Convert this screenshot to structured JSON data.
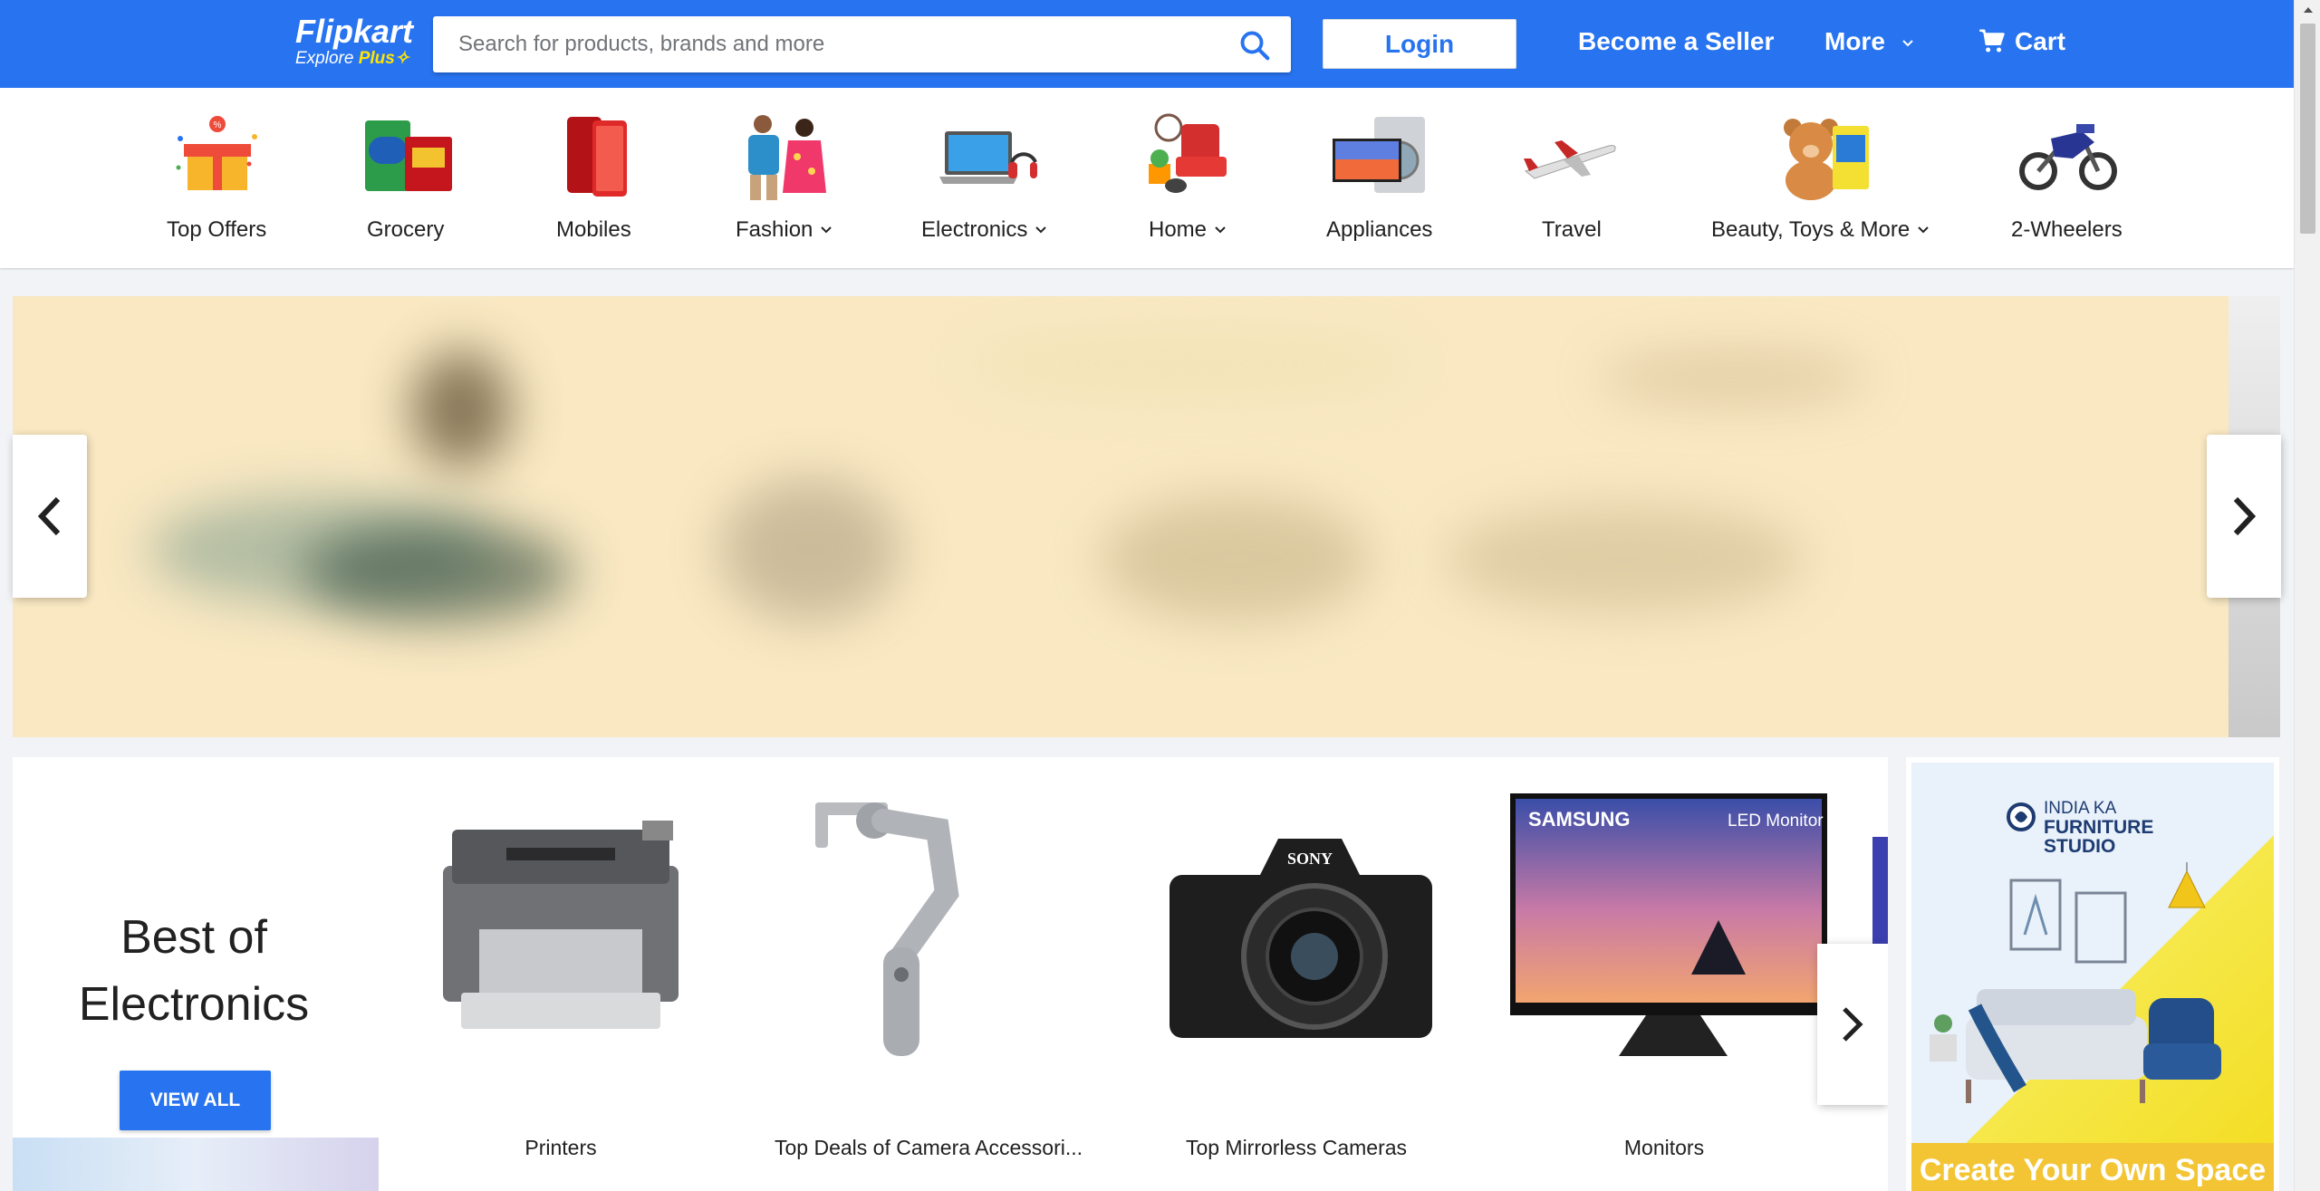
{
  "header": {
    "logo": {
      "name": "Flipkart",
      "sub": "Explore",
      "sub_plus": "Plus"
    },
    "search": {
      "placeholder": "Search for products, brands and more",
      "value": ""
    },
    "login_label": "Login",
    "seller_label": "Become a Seller",
    "more_label": "More",
    "cart_label": "Cart",
    "brand_color": "#2874f0"
  },
  "categories": [
    {
      "label": "Top Offers",
      "dropdown": false
    },
    {
      "label": "Grocery",
      "dropdown": false
    },
    {
      "label": "Mobiles",
      "dropdown": false
    },
    {
      "label": "Fashion",
      "dropdown": true
    },
    {
      "label": "Electronics",
      "dropdown": true
    },
    {
      "label": "Home",
      "dropdown": true
    },
    {
      "label": "Appliances",
      "dropdown": false
    },
    {
      "label": "Travel",
      "dropdown": false
    },
    {
      "label": "Beauty, Toys & More",
      "dropdown": true
    },
    {
      "label": "2-Wheelers",
      "dropdown": false
    }
  ],
  "best_of_electronics": {
    "title_line1": "Best of",
    "title_line2": "Electronics",
    "view_all_label": "VIEW ALL",
    "products": [
      {
        "name": "Printers",
        "icon": "printer"
      },
      {
        "name": "Top Deals of Camera Accessori...",
        "icon": "camera-gimbal"
      },
      {
        "name": "Top Mirrorless Cameras",
        "icon": "mirrorless-camera"
      },
      {
        "name": "Monitors",
        "icon": "monitor"
      }
    ],
    "monitor_brand": "SAMSUNG",
    "monitor_tag": "LED Monitor"
  },
  "ad": {
    "brand_line1": "INDIA KA",
    "brand_line2": "FURNITURE",
    "brand_line3": "STUDIO",
    "tagline": "Create Your Own Space"
  }
}
